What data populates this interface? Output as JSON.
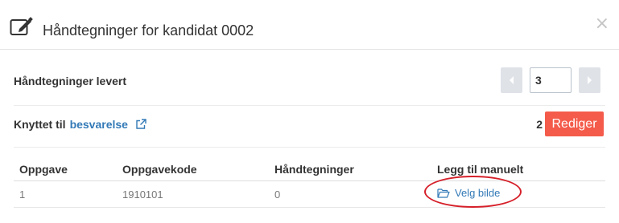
{
  "modal": {
    "title": "Håndtegninger for kandidat 0002",
    "close_symbol": "×"
  },
  "delivered": {
    "label": "Håndtegninger levert",
    "value": "3"
  },
  "linked": {
    "label": "Knyttet til",
    "link_text": "besvarelse",
    "count": "2",
    "edit_button": "Rediger"
  },
  "table": {
    "headers": [
      "Oppgave",
      "Oppgavekode",
      "Håndtegninger",
      "Legg til manuelt"
    ],
    "rows": [
      {
        "oppgave": "1",
        "oppgavekode": "1910101",
        "handtegninger": "0",
        "action": "Velg bilde"
      }
    ]
  },
  "icons": {
    "header": "edit-icon",
    "prev": "chevron-left-icon",
    "next": "chevron-right-icon",
    "external": "external-link-icon",
    "folder": "folder-open-icon",
    "close": "close-icon"
  },
  "colors": {
    "link": "#337ab7",
    "danger_button": "#f45b4a",
    "annotation_circle": "#d6202a"
  }
}
